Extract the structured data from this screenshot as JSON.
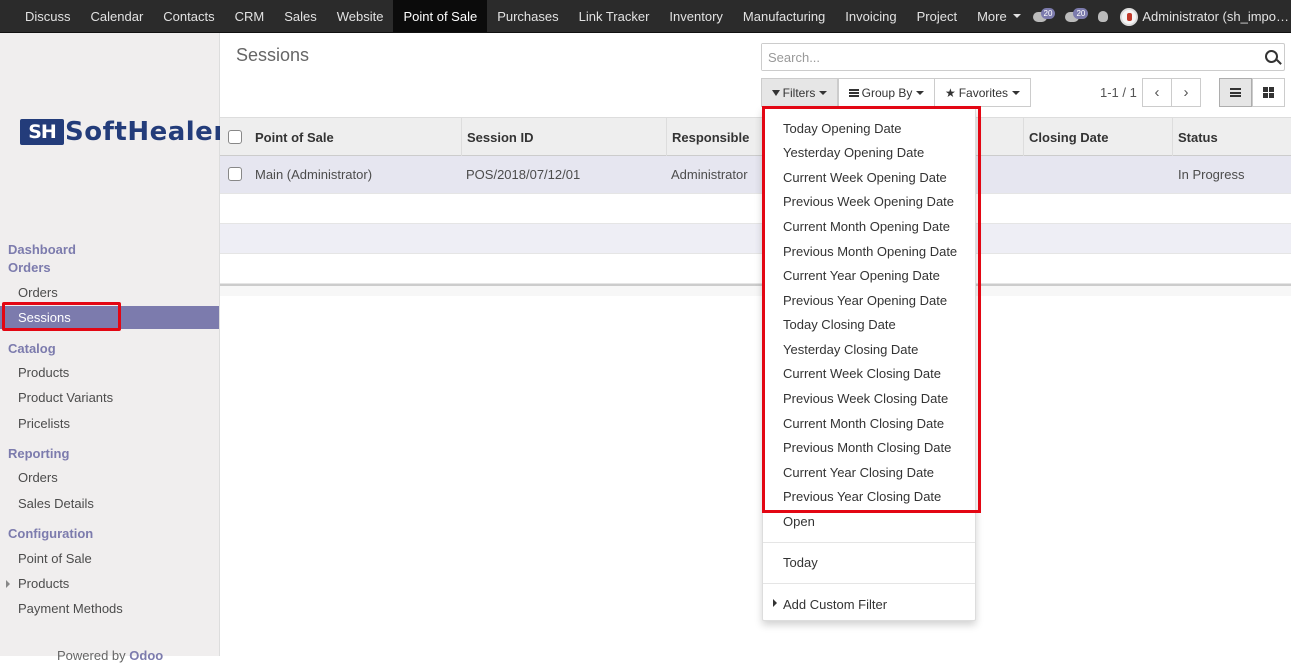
{
  "topbar": {
    "apps": [
      "Discuss",
      "Calendar",
      "Contacts",
      "CRM",
      "Sales",
      "Website",
      "Point of Sale",
      "Purchases",
      "Link Tracker",
      "Inventory",
      "Manufacturing",
      "Invoicing",
      "Project"
    ],
    "more_label": "More",
    "active_app": "Point of Sale",
    "chat_count": "20",
    "activity_count": "20",
    "user_name": "Administrator (sh_impo…"
  },
  "sidebar": {
    "logo_mark": "SH",
    "logo_text": "SoftHealer",
    "sections": {
      "dashboard": "Dashboard",
      "orders": "Orders",
      "catalog": "Catalog",
      "reporting": "Reporting",
      "configuration": "Configuration"
    },
    "items": {
      "orders": "Orders",
      "sessions": "Sessions",
      "products": "Products",
      "product_variants": "Product Variants",
      "pricelists": "Pricelists",
      "reporting_orders": "Orders",
      "sales_details": "Sales Details",
      "point_of_sale": "Point of Sale",
      "config_products": "Products",
      "payment_methods": "Payment Methods"
    },
    "powered_prefix": "Powered by",
    "powered_brand": "Odoo"
  },
  "control": {
    "breadcrumb": "Sessions",
    "search_placeholder": "Search...",
    "filters_label": "Filters",
    "groupby_label": "Group By",
    "favorites_label": "Favorites",
    "pager": "1-1 / 1",
    "prev_glyph": "‹",
    "next_glyph": "›"
  },
  "table": {
    "columns": [
      "Point of Sale",
      "Session ID",
      "Responsible",
      "Closing Date",
      "Status"
    ],
    "rows": [
      {
        "pos": "Main (Administrator)",
        "session": "POS/2018/07/12/01",
        "responsible": "Administrator",
        "closing": "",
        "status": "In Progress"
      }
    ]
  },
  "filters_menu": {
    "date_filters": [
      "Today Opening Date",
      "Yesterday Opening Date",
      "Current Week Opening Date",
      "Previous Week Opening Date",
      "Current Month Opening Date",
      "Previous Month Opening Date",
      "Current Year Opening Date",
      "Previous Year Opening Date",
      "Today Closing Date",
      "Yesterday Closing Date",
      "Current Week Closing Date",
      "Previous Week Closing Date",
      "Current Month Closing Date",
      "Previous Month Closing Date",
      "Current Year Closing Date",
      "Previous Year Closing Date"
    ],
    "open": "Open",
    "today": "Today",
    "add_custom": "Add Custom Filter"
  },
  "colors": {
    "brand": "#7c7bad",
    "highlight": "#e30613",
    "navbar": "#2b2b2b",
    "logo": "#233c7a"
  }
}
